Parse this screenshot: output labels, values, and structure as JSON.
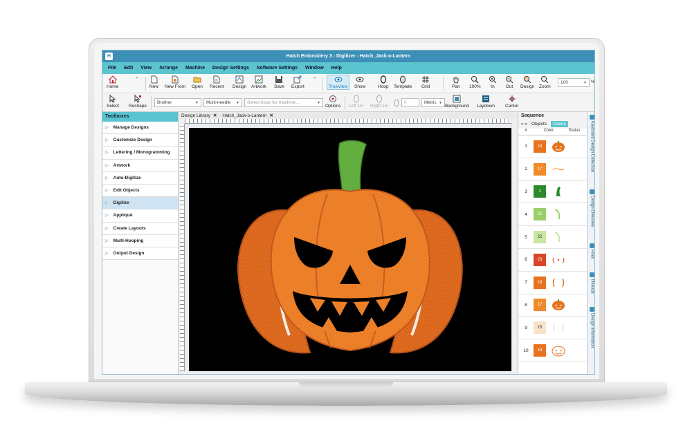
{
  "window": {
    "title": "Hatch Embroidery 3 - Digitizer - Hatch_Jack-o-Lantern",
    "logo": "H"
  },
  "menu": [
    "File",
    "Edit",
    "View",
    "Arrange",
    "Machine",
    "Design Settings",
    "Software Settings",
    "Window",
    "Help"
  ],
  "toolbar1": {
    "home": "Home",
    "new": "New",
    "new_from": "New From",
    "open": "Open",
    "recent": "Recent",
    "design": "Design",
    "artwork": "Artwork",
    "save": "Save",
    "export": "Export",
    "trueview": "TrueView",
    "show": "Show",
    "hoop": "Hoop",
    "template": "Template",
    "grid": "Grid",
    "pan": "Pan",
    "zoom100": "100%",
    "zoom_in": "In",
    "zoom_out": "Out",
    "zoom_design": "Design",
    "zoom": "Zoom",
    "zoom_value": "100",
    "zoom_unit": "%"
  },
  "toolbar2": {
    "select": "Select",
    "reshape": "Reshape",
    "machine": "Brother",
    "machine_type": "Multi-needle",
    "hoop_placeholder": "Select hoop for machine...",
    "options": "Options",
    "left15": "Left 15°",
    "right15": "Right 15°",
    "angle_value": "0",
    "units": "Metric",
    "background": "Background",
    "laydown": "Laydown",
    "center": "Center"
  },
  "toolboxes": {
    "title": "Toolboxes",
    "items": [
      {
        "label": "Manage Designs",
        "selected": false
      },
      {
        "label": "Customize Design",
        "selected": false
      },
      {
        "label": "Lettering / Monogramming",
        "selected": false
      },
      {
        "label": "Artwork",
        "selected": false
      },
      {
        "label": "Auto-Digitize",
        "selected": false
      },
      {
        "label": "Edit Objects",
        "selected": false
      },
      {
        "label": "Digitize",
        "selected": true
      },
      {
        "label": "Appliqué",
        "selected": false
      },
      {
        "label": "Create Layouts",
        "selected": false
      },
      {
        "label": "Multi-Hooping",
        "selected": false
      },
      {
        "label": "Output Design",
        "selected": false
      }
    ]
  },
  "tabs": [
    {
      "label": "Design Library",
      "close": "✕"
    },
    {
      "label": "Hatch_Jack-o-Lantern",
      "close": "✕"
    }
  ],
  "sequence": {
    "title": "Sequence",
    "nav": "« »",
    "tab_objects": "Objects",
    "tab_colors": "Colors",
    "col_num": "#",
    "col_color": "Color",
    "col_status": "Status",
    "rows": [
      {
        "num": "1",
        "code": "19",
        "color": "#e8731f",
        "thumb": "pumpkin"
      },
      {
        "num": "2",
        "code": "17",
        "color": "#f08a2b",
        "thumb": "dash"
      },
      {
        "num": "3",
        "code": "1",
        "color": "#2c8a2c",
        "thumb": "stem"
      },
      {
        "num": "4",
        "code": "21",
        "color": "#9bcf6a",
        "thumb": "curve"
      },
      {
        "num": "5",
        "code": "22",
        "color": "#c6e79f",
        "thumb": "curve-light"
      },
      {
        "num": "6",
        "code": "23",
        "color": "#d8462a",
        "thumb": "dots"
      },
      {
        "num": "7",
        "code": "19",
        "color": "#e8731f",
        "thumb": "brackets"
      },
      {
        "num": "8",
        "code": "17",
        "color": "#f08a2b",
        "thumb": "pumpkin"
      },
      {
        "num": "9",
        "code": "15",
        "color": "#f7e4c8",
        "thumb": "lines"
      },
      {
        "num": "10",
        "code": "19",
        "color": "#e8731f",
        "thumb": "face"
      }
    ]
  },
  "side_tabs": [
    "Keyboard Design Collection",
    "Design Overview",
    "Hints",
    "Threads",
    "Design Information"
  ],
  "colors": {
    "title_bar": "#3c8fb6",
    "menu_bar": "#5bc4cf",
    "pumpkin": "#e8731f",
    "stem": "#5ca83a"
  }
}
